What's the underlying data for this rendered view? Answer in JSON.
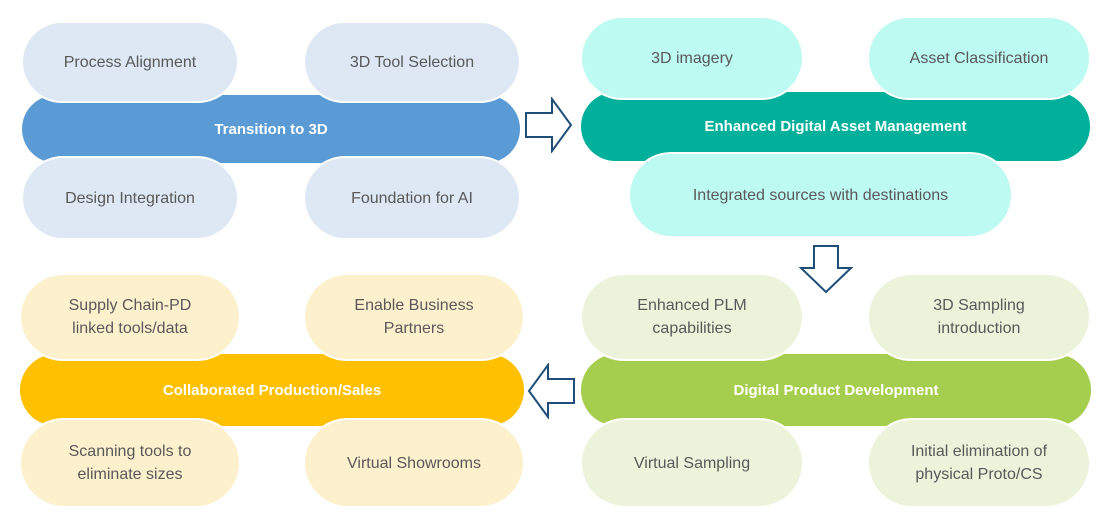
{
  "stages": [
    {
      "id": "transition",
      "title": "Transition to 3D",
      "color": "#5b9bd5",
      "items": [
        "Process Alignment",
        "3D Tool Selection",
        "Design Integration",
        "Foundation for AI"
      ]
    },
    {
      "id": "dam",
      "title": "Enhanced Digital Asset Management",
      "color": "#00b09b",
      "items": [
        "3D imagery",
        "Asset Classification",
        "Integrated sources with destinations"
      ]
    },
    {
      "id": "dpd",
      "title": "Digital Product Development",
      "color": "#a5ce4e",
      "items": [
        "Enhanced PLM capabilities",
        "3D Sampling introduction",
        "Virtual Sampling",
        "Initial elimination of physical Proto/CS"
      ]
    },
    {
      "id": "collab",
      "title": "Collaborated Production/Sales",
      "color": "#ffc000",
      "items": [
        "Supply Chain-PD linked tools/data",
        "Enable Business Partners",
        "Scanning tools to eliminate sizes",
        "Virtual Showrooms"
      ]
    }
  ],
  "arrows": [
    {
      "direction": "right",
      "from": "Transition to 3D",
      "to": "Enhanced Digital Asset Management"
    },
    {
      "direction": "down",
      "from": "Enhanced Digital Asset Management",
      "to": "Digital Product Development"
    },
    {
      "direction": "left",
      "from": "Digital Product Development",
      "to": "Collaborated Production/Sales"
    }
  ],
  "arrow_color": "#1f4e79"
}
